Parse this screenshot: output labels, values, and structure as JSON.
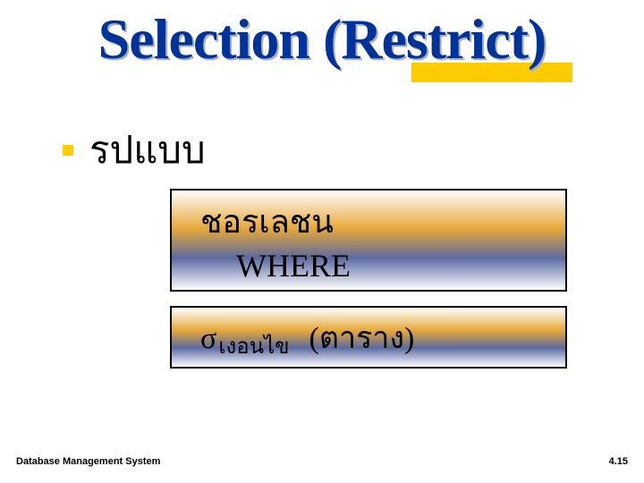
{
  "title": "Selection (Restrict)",
  "bullet": "รปแบบ",
  "box1_line1": "ชอรเลชน",
  "box1_line2": "WHERE",
  "box2_sigma": "σ",
  "box2_sub": "เงอนไข",
  "box2_rest": "(ตาราง)",
  "footer_left": "Database Management System",
  "footer_right": "4.15"
}
